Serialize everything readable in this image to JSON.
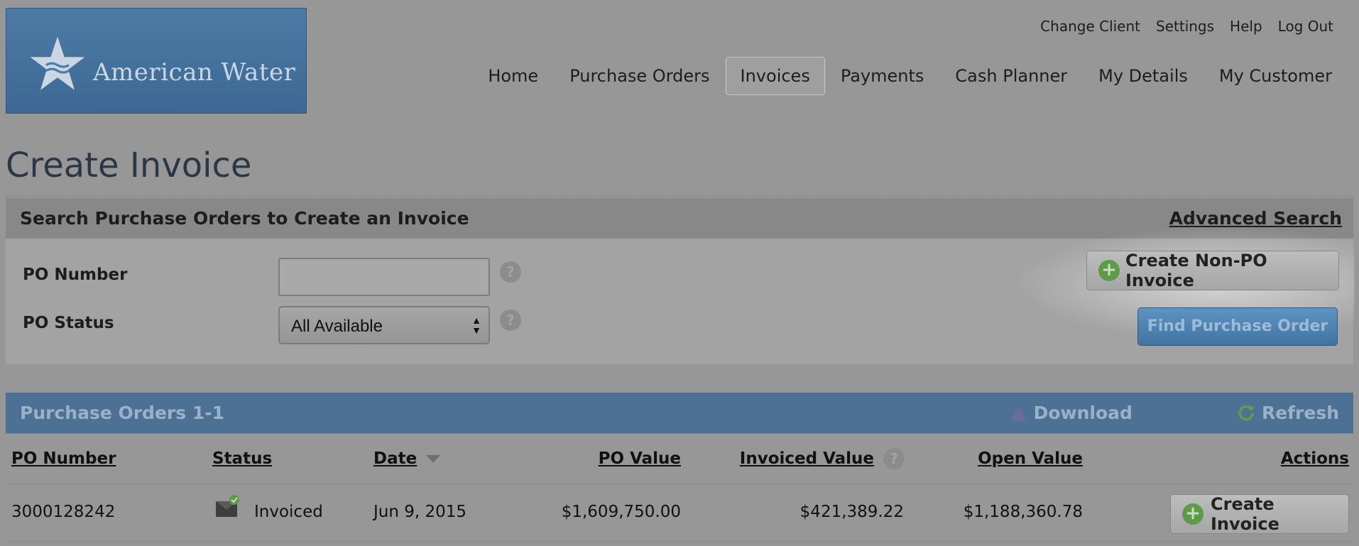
{
  "brand": {
    "name": "American Water"
  },
  "top_links": [
    "Change Client",
    "Settings",
    "Help",
    "Log Out"
  ],
  "main_nav": [
    {
      "label": "Home",
      "active": false
    },
    {
      "label": "Purchase Orders",
      "active": false
    },
    {
      "label": "Invoices",
      "active": true
    },
    {
      "label": "Payments",
      "active": false
    },
    {
      "label": "Cash Planner",
      "active": false
    },
    {
      "label": "My Details",
      "active": false
    },
    {
      "label": "My Customer",
      "active": false
    }
  ],
  "page_title": "Create Invoice",
  "search": {
    "header": "Search Purchase Orders to Create an Invoice",
    "advanced_link": "Advanced Search",
    "po_number_label": "PO Number",
    "po_number_value": "",
    "po_status_label": "PO Status",
    "po_status_selected": "All Available",
    "help_glyph": "?",
    "create_nonpo_label": "Create Non-PO Invoice",
    "find_label": "Find Purchase Order"
  },
  "results": {
    "header": "Purchase Orders 1-1",
    "download_label": "Download",
    "refresh_label": "Refresh",
    "columns": [
      "PO Number",
      "Status",
      "Date",
      "PO Value",
      "Invoiced Value",
      "Open Value",
      "Actions"
    ],
    "rows": [
      {
        "po_number": "3000128242",
        "status": "Invoiced",
        "date": "Jun 9, 2015",
        "po_value": "$1,609,750.00",
        "invoiced_value": "$421,389.22",
        "open_value": "$1,188,360.78",
        "action_label": "Create Invoice"
      }
    ]
  },
  "icons": {
    "plus": "+",
    "sort": "sort-desc-icon",
    "status": "invoiced-status-icon"
  },
  "colors": {
    "brand_blue": "#4e7ba6",
    "panel_header": "#4d7194",
    "primary_button": "#3f74a3",
    "plus_green": "#5d9a4a"
  }
}
